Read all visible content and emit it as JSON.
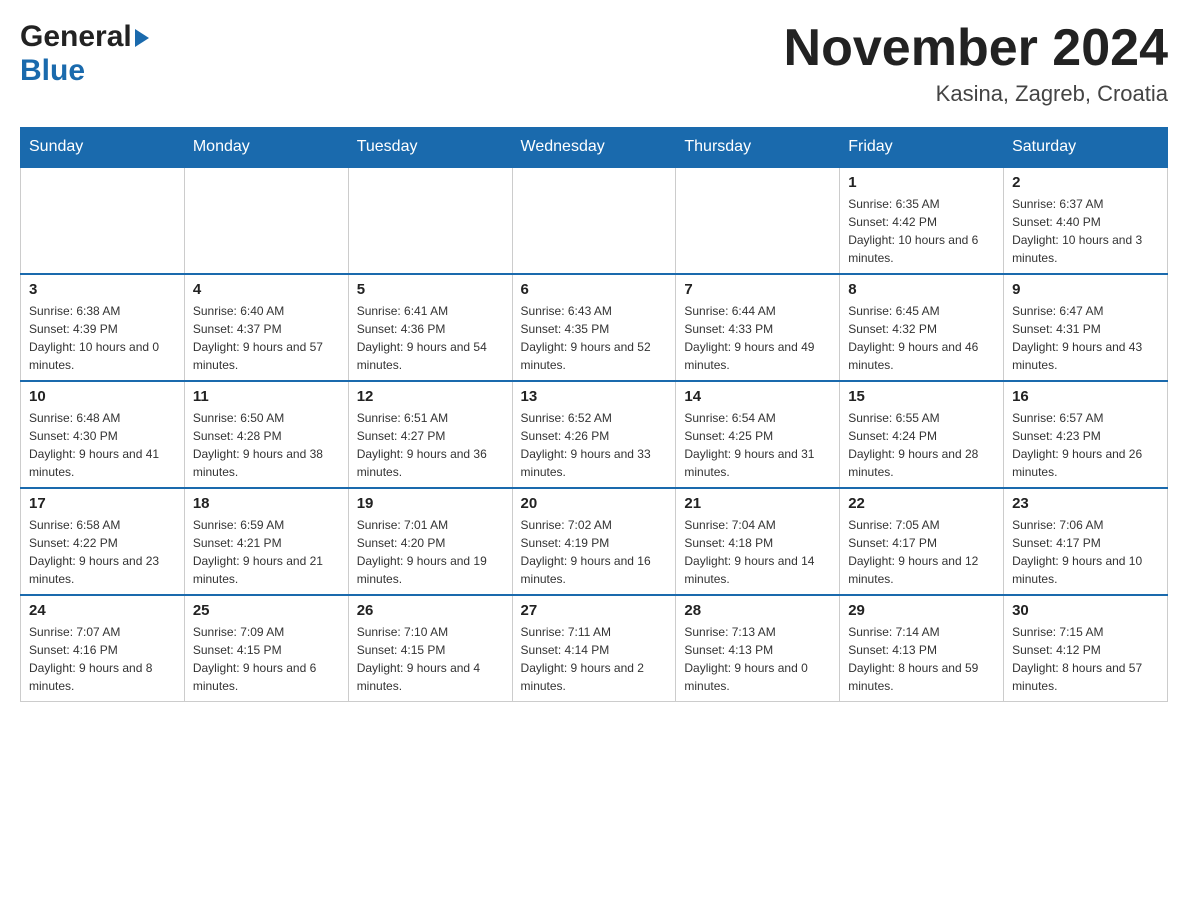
{
  "header": {
    "month_title": "November 2024",
    "location": "Kasina, Zagreb, Croatia",
    "logo_general": "General",
    "logo_blue": "Blue"
  },
  "days_of_week": [
    "Sunday",
    "Monday",
    "Tuesday",
    "Wednesday",
    "Thursday",
    "Friday",
    "Saturday"
  ],
  "weeks": [
    [
      {
        "day": "",
        "info": ""
      },
      {
        "day": "",
        "info": ""
      },
      {
        "day": "",
        "info": ""
      },
      {
        "day": "",
        "info": ""
      },
      {
        "day": "",
        "info": ""
      },
      {
        "day": "1",
        "info": "Sunrise: 6:35 AM\nSunset: 4:42 PM\nDaylight: 10 hours and 6 minutes."
      },
      {
        "day": "2",
        "info": "Sunrise: 6:37 AM\nSunset: 4:40 PM\nDaylight: 10 hours and 3 minutes."
      }
    ],
    [
      {
        "day": "3",
        "info": "Sunrise: 6:38 AM\nSunset: 4:39 PM\nDaylight: 10 hours and 0 minutes."
      },
      {
        "day": "4",
        "info": "Sunrise: 6:40 AM\nSunset: 4:37 PM\nDaylight: 9 hours and 57 minutes."
      },
      {
        "day": "5",
        "info": "Sunrise: 6:41 AM\nSunset: 4:36 PM\nDaylight: 9 hours and 54 minutes."
      },
      {
        "day": "6",
        "info": "Sunrise: 6:43 AM\nSunset: 4:35 PM\nDaylight: 9 hours and 52 minutes."
      },
      {
        "day": "7",
        "info": "Sunrise: 6:44 AM\nSunset: 4:33 PM\nDaylight: 9 hours and 49 minutes."
      },
      {
        "day": "8",
        "info": "Sunrise: 6:45 AM\nSunset: 4:32 PM\nDaylight: 9 hours and 46 minutes."
      },
      {
        "day": "9",
        "info": "Sunrise: 6:47 AM\nSunset: 4:31 PM\nDaylight: 9 hours and 43 minutes."
      }
    ],
    [
      {
        "day": "10",
        "info": "Sunrise: 6:48 AM\nSunset: 4:30 PM\nDaylight: 9 hours and 41 minutes."
      },
      {
        "day": "11",
        "info": "Sunrise: 6:50 AM\nSunset: 4:28 PM\nDaylight: 9 hours and 38 minutes."
      },
      {
        "day": "12",
        "info": "Sunrise: 6:51 AM\nSunset: 4:27 PM\nDaylight: 9 hours and 36 minutes."
      },
      {
        "day": "13",
        "info": "Sunrise: 6:52 AM\nSunset: 4:26 PM\nDaylight: 9 hours and 33 minutes."
      },
      {
        "day": "14",
        "info": "Sunrise: 6:54 AM\nSunset: 4:25 PM\nDaylight: 9 hours and 31 minutes."
      },
      {
        "day": "15",
        "info": "Sunrise: 6:55 AM\nSunset: 4:24 PM\nDaylight: 9 hours and 28 minutes."
      },
      {
        "day": "16",
        "info": "Sunrise: 6:57 AM\nSunset: 4:23 PM\nDaylight: 9 hours and 26 minutes."
      }
    ],
    [
      {
        "day": "17",
        "info": "Sunrise: 6:58 AM\nSunset: 4:22 PM\nDaylight: 9 hours and 23 minutes."
      },
      {
        "day": "18",
        "info": "Sunrise: 6:59 AM\nSunset: 4:21 PM\nDaylight: 9 hours and 21 minutes."
      },
      {
        "day": "19",
        "info": "Sunrise: 7:01 AM\nSunset: 4:20 PM\nDaylight: 9 hours and 19 minutes."
      },
      {
        "day": "20",
        "info": "Sunrise: 7:02 AM\nSunset: 4:19 PM\nDaylight: 9 hours and 16 minutes."
      },
      {
        "day": "21",
        "info": "Sunrise: 7:04 AM\nSunset: 4:18 PM\nDaylight: 9 hours and 14 minutes."
      },
      {
        "day": "22",
        "info": "Sunrise: 7:05 AM\nSunset: 4:17 PM\nDaylight: 9 hours and 12 minutes."
      },
      {
        "day": "23",
        "info": "Sunrise: 7:06 AM\nSunset: 4:17 PM\nDaylight: 9 hours and 10 minutes."
      }
    ],
    [
      {
        "day": "24",
        "info": "Sunrise: 7:07 AM\nSunset: 4:16 PM\nDaylight: 9 hours and 8 minutes."
      },
      {
        "day": "25",
        "info": "Sunrise: 7:09 AM\nSunset: 4:15 PM\nDaylight: 9 hours and 6 minutes."
      },
      {
        "day": "26",
        "info": "Sunrise: 7:10 AM\nSunset: 4:15 PM\nDaylight: 9 hours and 4 minutes."
      },
      {
        "day": "27",
        "info": "Sunrise: 7:11 AM\nSunset: 4:14 PM\nDaylight: 9 hours and 2 minutes."
      },
      {
        "day": "28",
        "info": "Sunrise: 7:13 AM\nSunset: 4:13 PM\nDaylight: 9 hours and 0 minutes."
      },
      {
        "day": "29",
        "info": "Sunrise: 7:14 AM\nSunset: 4:13 PM\nDaylight: 8 hours and 59 minutes."
      },
      {
        "day": "30",
        "info": "Sunrise: 7:15 AM\nSunset: 4:12 PM\nDaylight: 8 hours and 57 minutes."
      }
    ]
  ]
}
